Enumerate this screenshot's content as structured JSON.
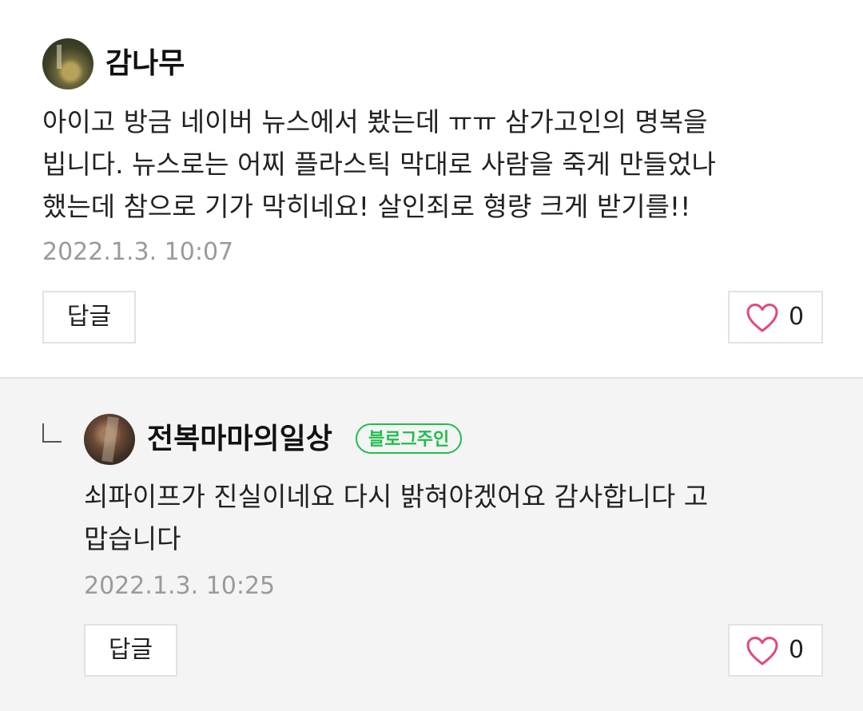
{
  "colors": {
    "owner_badge": "#1fbe4e",
    "heart": "#e24a7a",
    "timestamp": "#9a9a9a",
    "reply_background": "#f4f4f4"
  },
  "comments": [
    {
      "author": "감나무",
      "avatar_icon": "profile-photo",
      "text": "아이고 방금 네이버 뉴스에서 봤는데 ㅠㅠ 삼가고인의 명복을\n빕니다. 뉴스로는 어찌 플라스틱 막대로 사람을 죽게 만들었나\n했는데 참으로 기가 막히네요! 살인죄로 형량 크게 받기를!!",
      "timestamp": "2022.1.3. 10:07",
      "reply_label": "답글",
      "like_icon": "heart-outline-icon",
      "like_count": "0"
    },
    {
      "author": "전복마마의일상",
      "badge": "블로그주인",
      "is_reply": true,
      "reply_indicator_icon": "reply-arrow-icon",
      "avatar_icon": "profile-photo",
      "text": "쇠파이프가 진실이네요 다시 밝혀야겠어요 감사합니다 고\n맙습니다",
      "timestamp": "2022.1.3. 10:25",
      "reply_label": "답글",
      "like_icon": "heart-outline-icon",
      "like_count": "0"
    }
  ]
}
